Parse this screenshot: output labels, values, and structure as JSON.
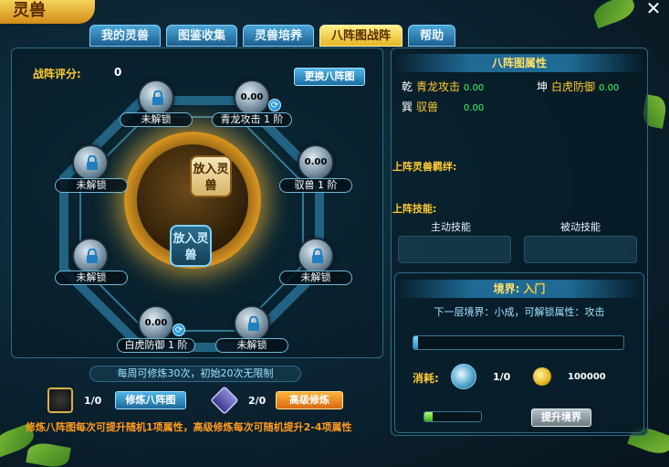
{
  "window": {
    "badge": "灵兽",
    "close": "✕"
  },
  "tabs": [
    {
      "label": "我的灵兽",
      "active": false
    },
    {
      "label": "图鉴收集",
      "active": false
    },
    {
      "label": "灵兽培养",
      "active": false
    },
    {
      "label": "八阵图战阵",
      "active": true
    },
    {
      "label": "帮助",
      "active": false
    }
  ],
  "formation": {
    "score_label": "战阵评分:",
    "score_value": "0",
    "change_button": "更换八阵图",
    "center_slots": [
      "放入灵兽",
      "放入灵兽"
    ],
    "nodes": [
      {
        "state": "locked",
        "label": "未解锁",
        "icon": "lock-icon"
      },
      {
        "state": "open",
        "value": "0.00",
        "label": "青龙攻击 1 阶",
        "icon": "swap-icon"
      },
      {
        "state": "locked",
        "label": "未解锁",
        "icon": "lock-icon"
      },
      {
        "state": "open",
        "value": "0.00",
        "label": "驭兽 1 阶"
      },
      {
        "state": "locked",
        "label": "未解锁",
        "icon": "lock-icon"
      },
      {
        "state": "locked",
        "label": "未解锁",
        "icon": "lock-icon"
      },
      {
        "state": "open",
        "value": "0.00",
        "label": "白虎防御 1 阶",
        "icon": "swap-icon"
      },
      {
        "state": "locked",
        "label": "未解锁",
        "icon": "lock-icon"
      }
    ],
    "weekly_info": "每周可修炼30次，初始20次无限制",
    "train": {
      "count": "1/0",
      "button": "修炼八阵图"
    },
    "advanced": {
      "count": "2/0",
      "button": "高级修炼"
    },
    "tip": "修炼八阵图每次可提升随机1项属性，高级修炼每次可随机提升2-4项属性"
  },
  "attributes": {
    "header": "八阵图属性",
    "items": [
      {
        "key": "乾",
        "name": "青龙攻击",
        "value": "0.00"
      },
      {
        "key": "坤",
        "name": "白虎防御",
        "value": "0.00"
      },
      {
        "key": "巽",
        "name": "驭兽",
        "value": "0.00"
      }
    ],
    "bond_title": "上阵灵兽羁绊:",
    "skills_title": "上阵技能:",
    "active_skill": "主动技能",
    "passive_skill": "被动技能"
  },
  "realm": {
    "label": "境界:",
    "name": "入门",
    "next": "下一层境界：小成，可解锁属性：攻击",
    "progress": 0.01,
    "consume_label": "消耗:",
    "item_count": "1/0",
    "gold": "100000",
    "upgrade_button": "提升境界",
    "small_progress": 0.15
  },
  "colors": {
    "accent": "#ffcc33",
    "value_green": "#33ff66",
    "tab_active": "#f3d243"
  }
}
